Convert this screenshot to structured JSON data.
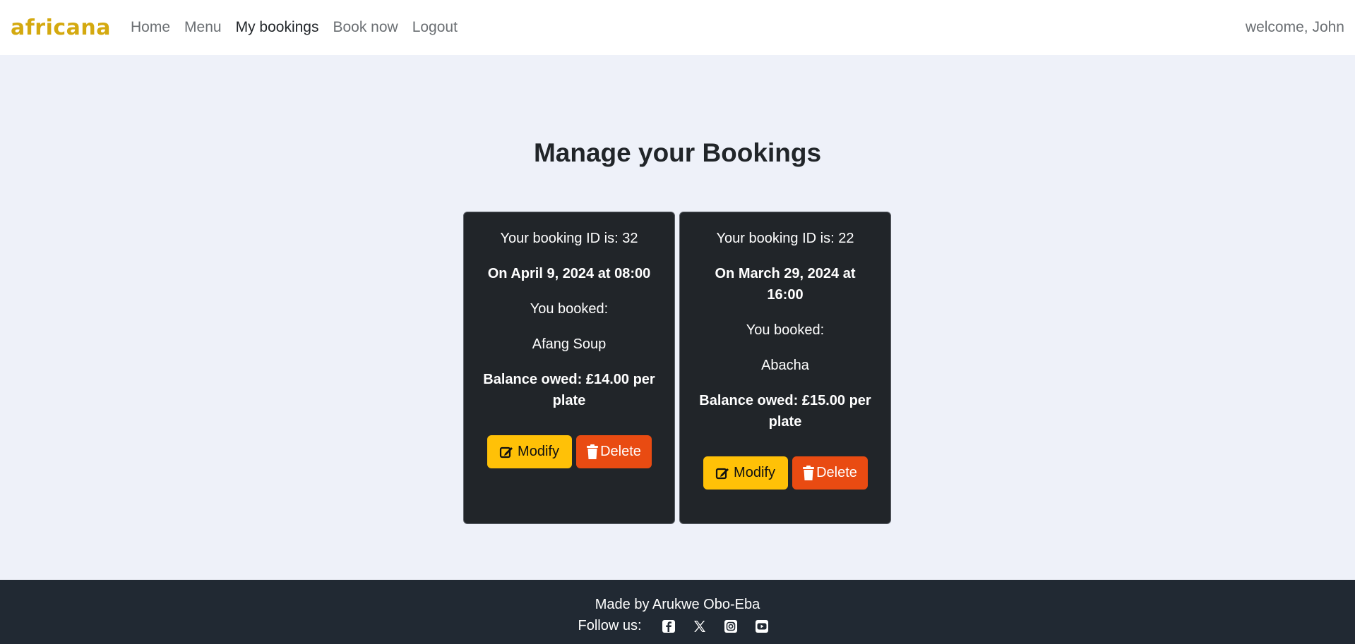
{
  "nav": {
    "brand": "africana",
    "links": [
      {
        "label": "Home"
      },
      {
        "label": "Menu"
      },
      {
        "label": "My bookings"
      },
      {
        "label": "Book now"
      },
      {
        "label": "Logout"
      }
    ],
    "active_index": 2,
    "welcome": "welcome, John"
  },
  "main": {
    "title": "Manage your Bookings",
    "bookings": [
      {
        "id_text": "Your booking ID is: 32",
        "date_text": "On April 9, 2024 at 08:00",
        "booked_label": "You booked:",
        "item": "Afang Soup",
        "balance_text": "Balance owed: £14.00 per plate",
        "modify_label": "Modify",
        "delete_label": "Delete"
      },
      {
        "id_text": "Your booking ID is: 22",
        "date_text": "On March 29, 2024 at 16:00",
        "booked_label": "You booked:",
        "item": "Abacha",
        "balance_text": "Balance owed: £15.00 per plate",
        "modify_label": "Modify",
        "delete_label": "Delete"
      }
    ]
  },
  "footer": {
    "made_by": "Made by Arukwe Obo-Eba",
    "follow_label": "Follow us:",
    "social_icons": [
      "facebook-icon",
      "x-twitter-icon",
      "instagram-icon",
      "youtube-icon"
    ]
  },
  "colors": {
    "brand": "#d4a90f",
    "background": "#eef1f9",
    "card": "#212529",
    "modify": "#ffc107",
    "delete": "#e94b12",
    "footer": "#212933"
  }
}
